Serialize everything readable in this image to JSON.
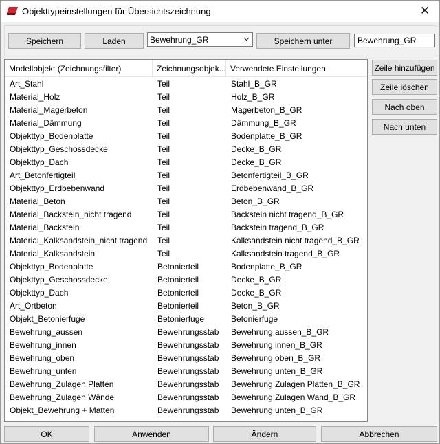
{
  "window": {
    "title": "Objekttypeinstellungen für Übersichtszeichnung",
    "close_glyph": "✕",
    "app_icon": "app-logo-icon"
  },
  "toolbar": {
    "save_label": "Speichern",
    "load_label": "Laden",
    "combo_value": "Bewehrung_GR",
    "save_as_label": "Speichern unter",
    "save_as_value": "Bewehrung_GR"
  },
  "table": {
    "columns": [
      "Modellobjekt (Zeichnungsfilter)",
      "Zeichnungsobjek...",
      "Verwendete Einstellungen"
    ],
    "rows": [
      [
        "Art_Stahl",
        "Teil",
        "Stahl_B_GR"
      ],
      [
        "Material_Holz",
        "Teil",
        "Holz_B_GR"
      ],
      [
        "Material_Magerbeton",
        "Teil",
        "Magerbeton_B_GR"
      ],
      [
        "Material_Dämmung",
        "Teil",
        "Dämmung_B_GR"
      ],
      [
        "Objekttyp_Bodenplatte",
        "Teil",
        "Bodenplatte_B_GR"
      ],
      [
        "Objekttyp_Geschossdecke",
        "Teil",
        "Decke_B_GR"
      ],
      [
        "Objekttyp_Dach",
        "Teil",
        "Decke_B_GR"
      ],
      [
        "Art_Betonfertigteil",
        "Teil",
        "Betonfertigteil_B_GR"
      ],
      [
        "Objekttyp_Erdbebenwand",
        "Teil",
        "Erdbebenwand_B_GR"
      ],
      [
        "Material_Beton",
        "Teil",
        "Beton_B_GR"
      ],
      [
        "Material_Backstein_nicht tragend",
        "Teil",
        "Backstein nicht tragend_B_GR"
      ],
      [
        "Material_Backstein",
        "Teil",
        "Backstein tragend_B_GR"
      ],
      [
        "Material_Kalksandstein_nicht tragend",
        "Teil",
        "Kalksandstein nicht tragend_B_GR"
      ],
      [
        "Material_Kalksandstein",
        "Teil",
        "Kalksandstein tragend_B_GR"
      ],
      [
        "Objekttyp_Bodenplatte",
        "Betonierteil",
        "Bodenplatte_B_GR"
      ],
      [
        "Objekttyp_Geschossdecke",
        "Betonierteil",
        "Decke_B_GR"
      ],
      [
        "Objekttyp_Dach",
        "Betonierteil",
        "Decke_B_GR"
      ],
      [
        "Art_Ortbeton",
        "Betonierteil",
        "Beton_B_GR"
      ],
      [
        "Objekt_Betonierfuge",
        "Betonierfuge",
        "Betonierfuge"
      ],
      [
        "Bewehrung_aussen",
        "Bewehrungsstab",
        "Bewehrung aussen_B_GR"
      ],
      [
        "Bewehrung_innen",
        "Bewehrungsstab",
        "Bewehrung innen_B_GR"
      ],
      [
        "Bewehrung_oben",
        "Bewehrungsstab",
        "Bewehrung oben_B_GR"
      ],
      [
        "Bewehrung_unten",
        "Bewehrungsstab",
        "Bewehrung unten_B_GR"
      ],
      [
        "Bewehrung_Zulagen Platten",
        "Bewehrungsstab",
        "Bewehrung Zulagen Platten_B_GR"
      ],
      [
        "Bewehrung_Zulagen Wände",
        "Bewehrungsstab",
        "Bewehrung Zulagen Wand_B_GR"
      ],
      [
        "Objekt_Bewehrung + Matten",
        "Bewehrungsstab",
        "Bewehrung unten_B_GR"
      ]
    ]
  },
  "side_buttons": {
    "add_row": "Zeile hinzufügen",
    "delete_row": "Zeile löschen",
    "move_up": "Nach oben",
    "move_down": "Nach unten"
  },
  "bottom_buttons": {
    "ok": "OK",
    "apply": "Anwenden",
    "modify": "Ändern",
    "cancel": "Abbrechen"
  },
  "colors": {
    "icon_red": "#d2232a",
    "icon_dark": "#7a1016"
  }
}
